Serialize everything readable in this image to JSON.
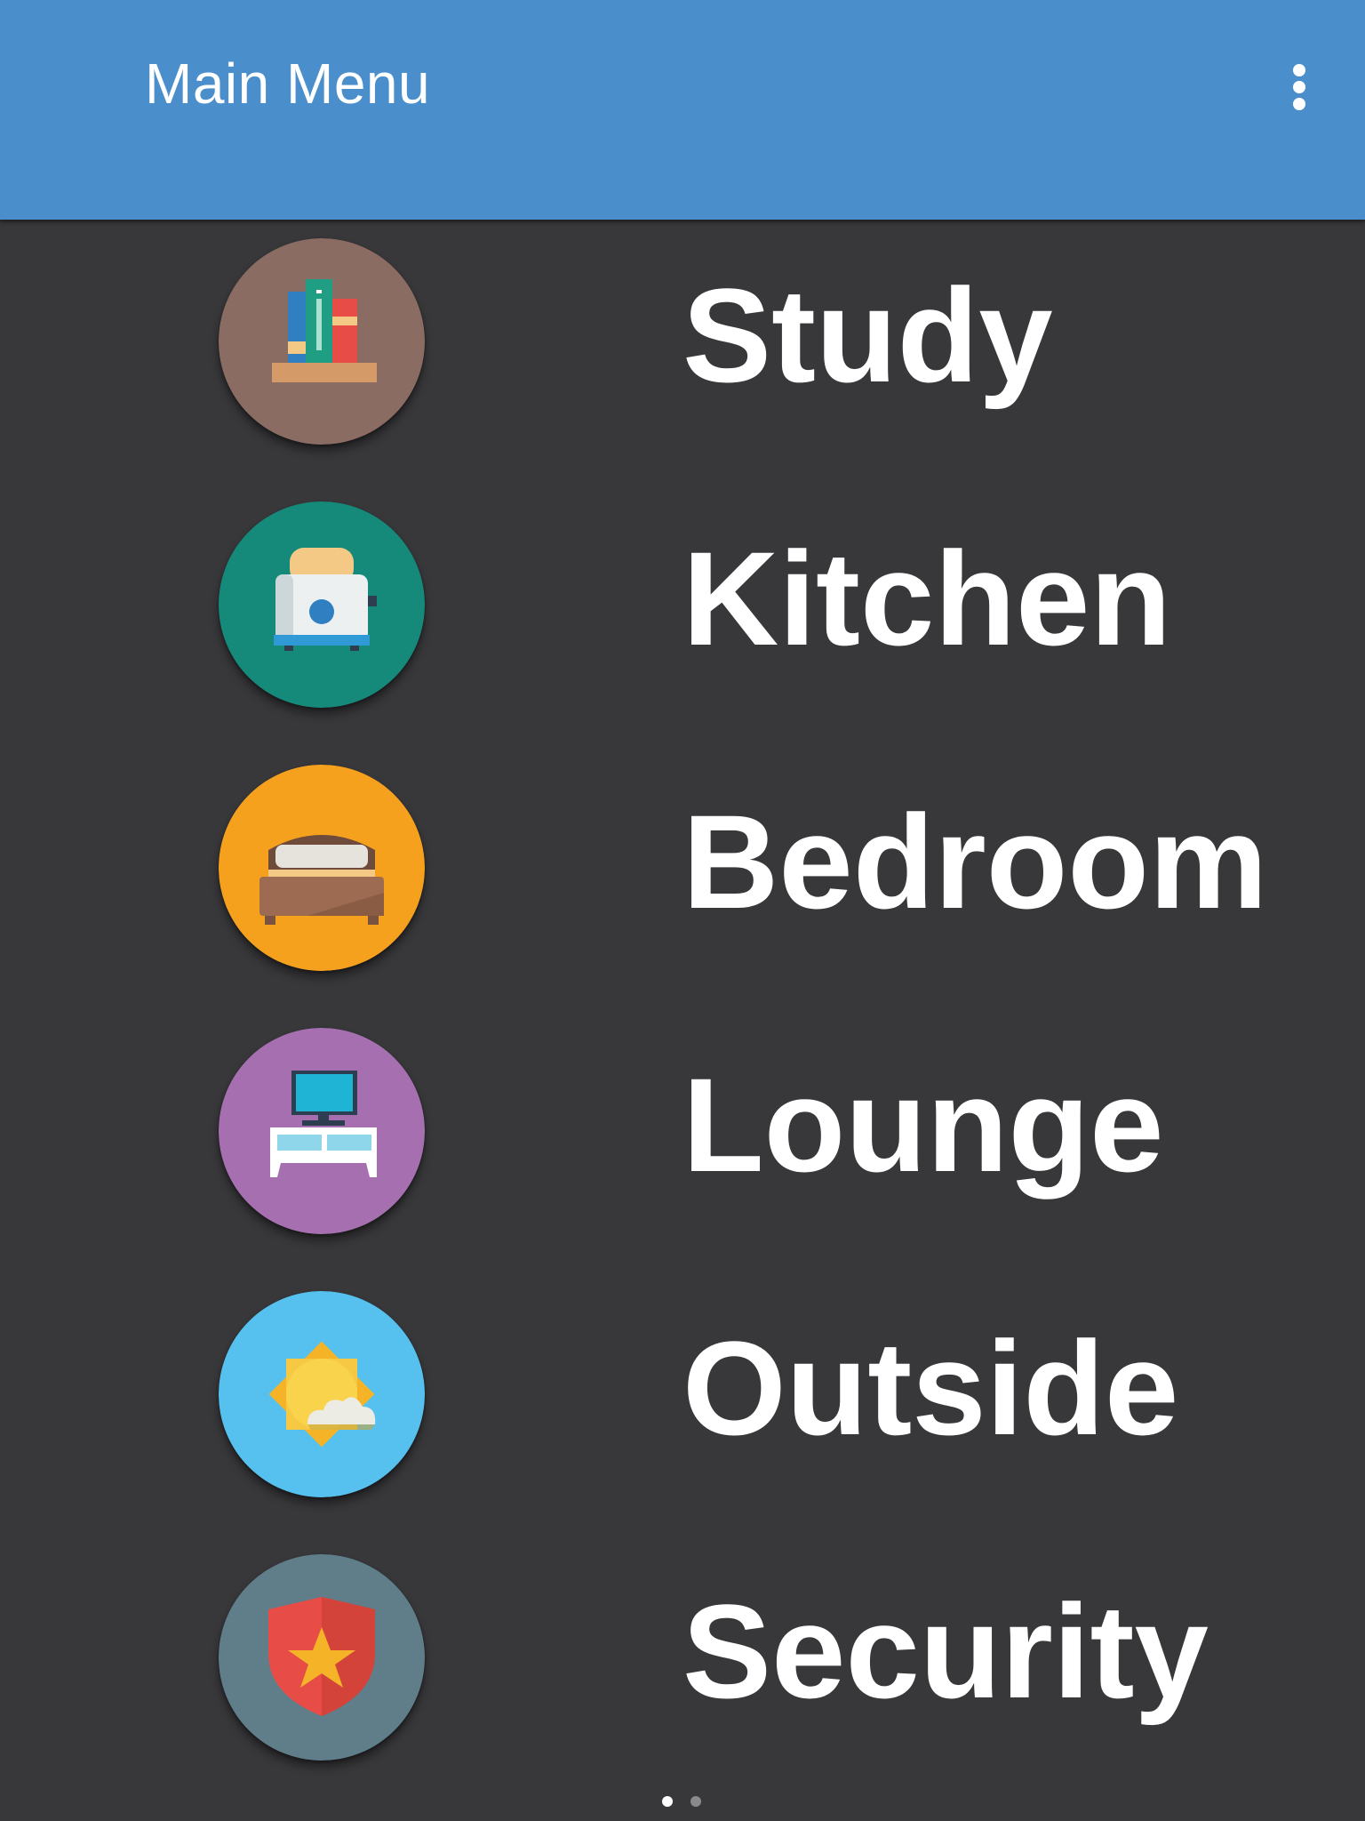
{
  "app_bar": {
    "title": "Main Menu",
    "overflow_icon": "more-vert-icon"
  },
  "menu": {
    "items": [
      {
        "label": "Study",
        "icon": "bookshelf-icon",
        "color": "#8a6c62"
      },
      {
        "label": "Kitchen",
        "icon": "toaster-icon",
        "color": "#15897a"
      },
      {
        "label": "Bedroom",
        "icon": "bed-icon",
        "color": "#f6a11e"
      },
      {
        "label": "Lounge",
        "icon": "tv-cabinet-icon",
        "color": "#a56fb0"
      },
      {
        "label": "Outside",
        "icon": "weather-icon",
        "color": "#56c1ee"
      },
      {
        "label": "Security",
        "icon": "shield-icon",
        "color": "#607d8a"
      }
    ]
  },
  "page_indicator": {
    "pages": 2,
    "current": 1
  },
  "colors": {
    "app_bar": "#4a8ecb",
    "background": "#38383b",
    "text": "#ffffff"
  }
}
